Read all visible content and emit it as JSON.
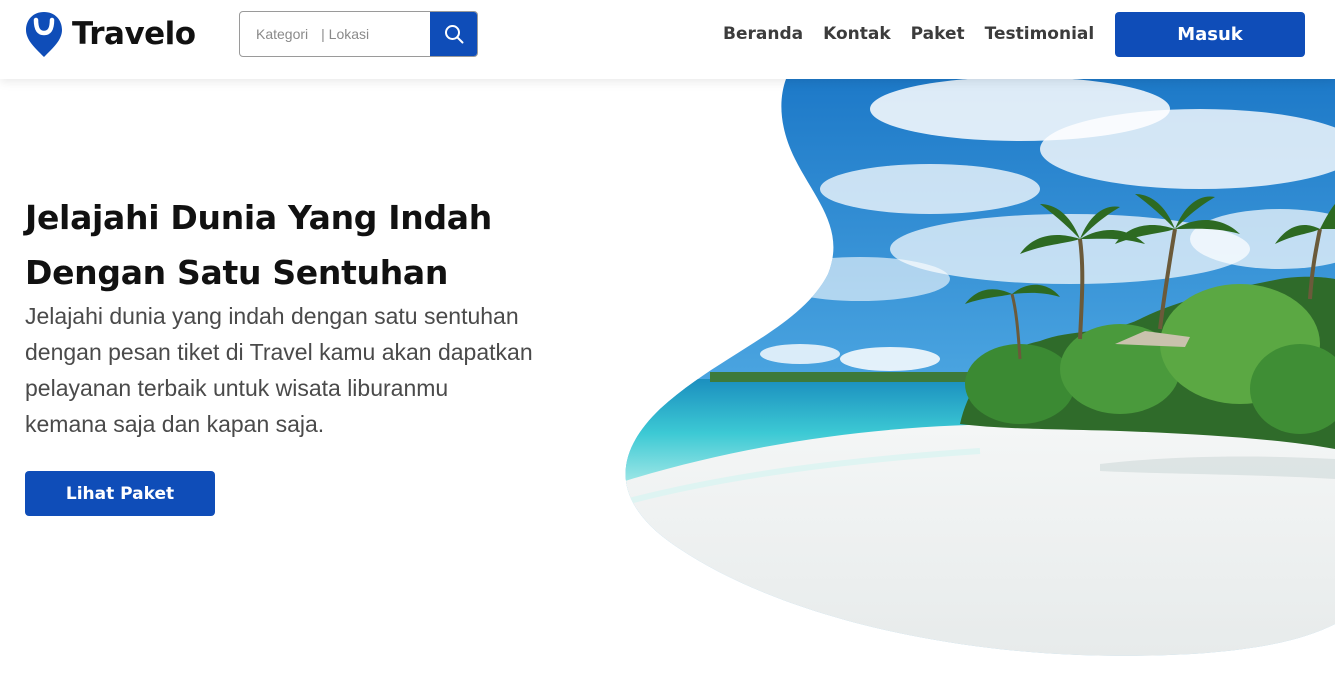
{
  "brand": {
    "name": "Travelo",
    "accent_color": "#0f4db8",
    "logo_icon": "map-pin-icon"
  },
  "search": {
    "category_label": "Kategori",
    "location_label": "| Lokasi",
    "button_icon": "search-icon"
  },
  "nav": {
    "links": [
      {
        "label": "Beranda"
      },
      {
        "label": "Kontak"
      },
      {
        "label": "Paket"
      },
      {
        "label": "Testimonial"
      }
    ],
    "login_label": "Masuk"
  },
  "hero": {
    "title_line1": "Jelajahi Dunia Yang Indah",
    "title_line2": "Dengan Satu Sentuhan",
    "description_lines": [
      "Jelajahi dunia yang indah dengan satu sentuhan",
      "dengan pesan tiket di Travel kamu akan dapatkan",
      "pelayanan terbaik untuk wisata liburanmu",
      "kemana saja dan kapan saja."
    ],
    "cta_label": "Lihat Paket",
    "image_subject": "tropical beach with palm trees and turquoise sea"
  }
}
